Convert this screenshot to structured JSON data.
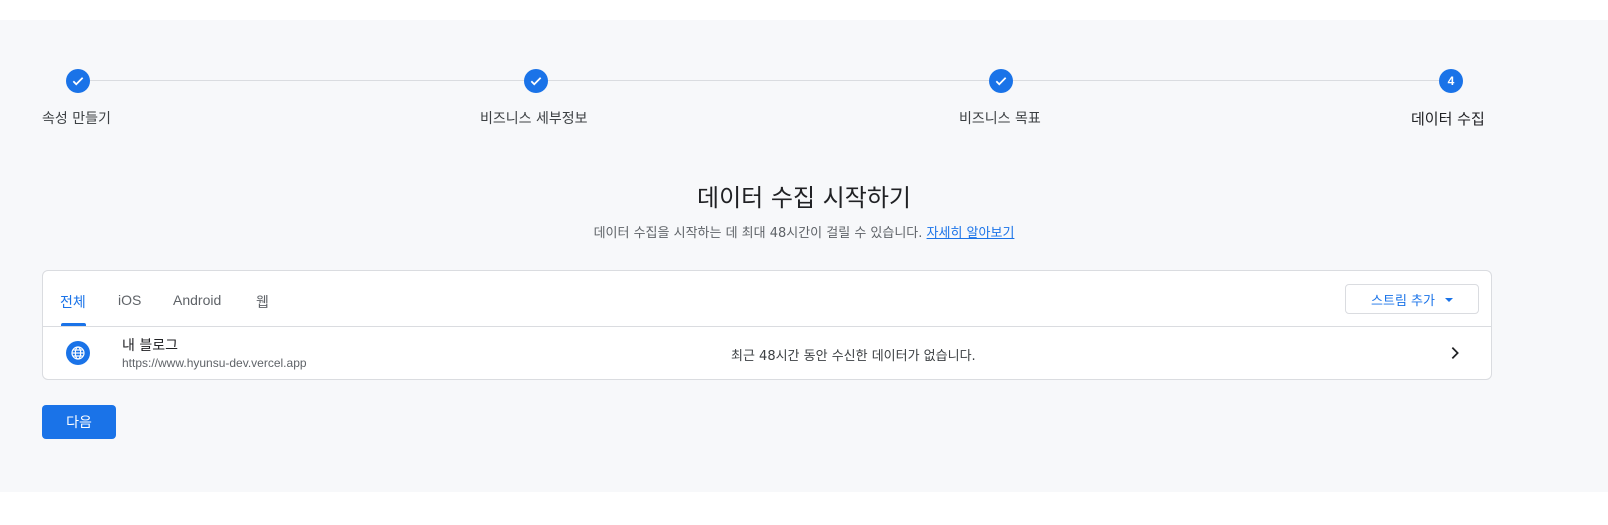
{
  "stepper": {
    "steps": [
      {
        "label": "속성 만들기",
        "state": "done",
        "icon": "check-icon"
      },
      {
        "label": "비즈니스 세부정보",
        "state": "done",
        "icon": "check-icon"
      },
      {
        "label": "비즈니스 목표",
        "state": "done",
        "icon": "check-icon"
      },
      {
        "label": "데이터 수집",
        "state": "current",
        "number": "4"
      }
    ]
  },
  "heading": {
    "title": "데이터 수집 시작하기",
    "subtitle": "데이터 수집을 시작하는 데 최대 48시간이 걸릴 수 있습니다.",
    "learn_more": "자세히 알아보기"
  },
  "streams": {
    "tabs": [
      {
        "label": "전체",
        "active": true
      },
      {
        "label": "iOS",
        "active": false
      },
      {
        "label": "Android",
        "active": false
      },
      {
        "label": "웹",
        "active": false
      }
    ],
    "add_stream_label": "스트림 추가",
    "items": [
      {
        "icon": "globe-icon",
        "name": "내 블로그",
        "url": "https://www.hyunsu-dev.vercel.app",
        "status": "최근 48시간 동안 수신한 데이터가 없습니다."
      }
    ]
  },
  "footer": {
    "next_label": "다음"
  },
  "colors": {
    "accent": "#1a73e8",
    "panel_background": "#f7f8fa",
    "border": "#dadce0"
  }
}
